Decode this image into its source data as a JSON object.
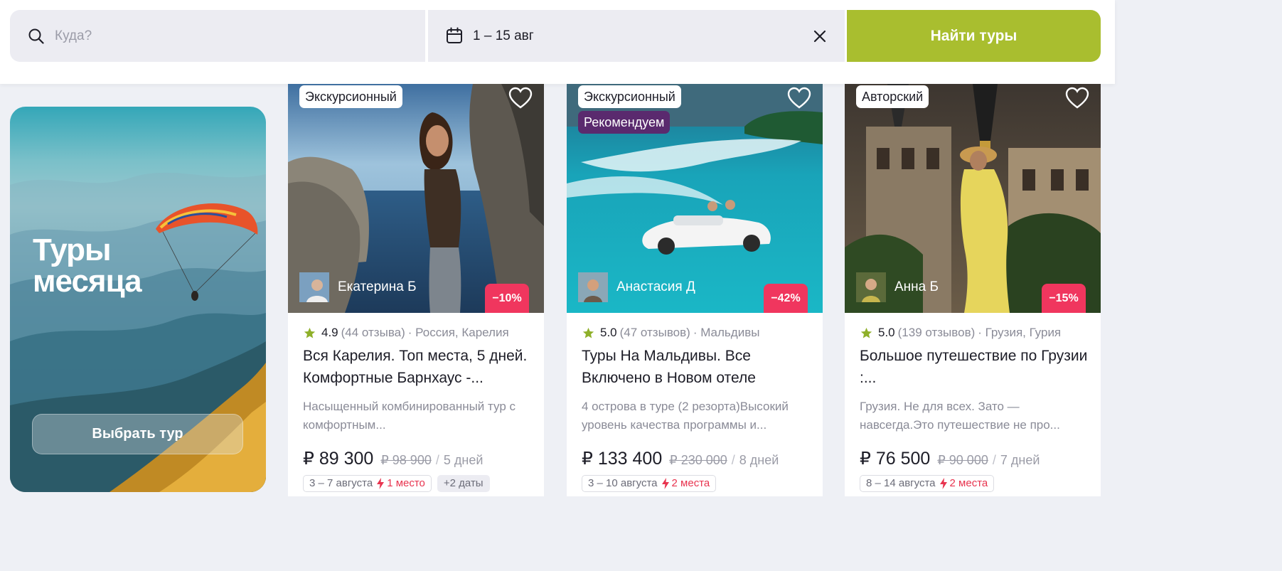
{
  "search": {
    "placeholder": "Куда?",
    "date_value": "1 – 15 авг",
    "find_label": "Найти туры",
    "icons": [
      "search-icon",
      "calendar-icon",
      "close-icon"
    ]
  },
  "promo": {
    "title_line1": "Туры",
    "title_line2": "месяца",
    "button_label": "Выбрать тур"
  },
  "colors": {
    "accent": "#a9be2f",
    "discount": "#f0365e",
    "recommend": "#5a2a6e",
    "star": "#8fb02a"
  },
  "cards": [
    {
      "tag": "Экскурсионный",
      "guide": "Екатерина Б",
      "discount": "−10%",
      "rating": "4.9",
      "reviews": "(44 отзыва)",
      "location": "· Россия, Карелия",
      "title": "Вся Карелия. Топ места, 5 дней. Комфортные Барнхаус -...",
      "description": "Насыщенный  комбинированный тур с комфортным...",
      "price": "₽ 89 300",
      "old_price": "₽ 98 900",
      "separator": "/",
      "duration": "5 дней",
      "date_range": "3 – 7 августа",
      "seats": "1 место",
      "more_dates": "+2 даты"
    },
    {
      "tag": "Экскурсионный",
      "tag2": "Рекомендуем",
      "guide": "Анастасия Д",
      "discount": "−42%",
      "rating": "5.0",
      "reviews": "(47 отзывов)",
      "location": "· Мальдивы",
      "title": "Туры На Мальдивы. Все Включено в Новом отеле",
      "description": "4 острова в туре (2 резорта)Высокий уровень качества программы и...",
      "price": "₽ 133 400",
      "old_price": "₽ 230 000",
      "separator": "/",
      "duration": "8 дней",
      "date_range": "3 – 10 августа",
      "seats": "2 места"
    },
    {
      "tag": "Авторский",
      "guide": "Анна Б",
      "discount": "−15%",
      "rating": "5.0",
      "reviews": "(139 отзывов)",
      "location": "· Грузия, Гурия",
      "title": "Большое путешествие по Грузии :...",
      "description": "Грузия. Не для всех. Зато — навсегда.Это путешествие не про...",
      "price": "₽ 76 500",
      "old_price": "₽ 90 000",
      "separator": "/",
      "duration": "7 дней",
      "date_range": "8 – 14 августа",
      "seats": "2 места"
    }
  ]
}
